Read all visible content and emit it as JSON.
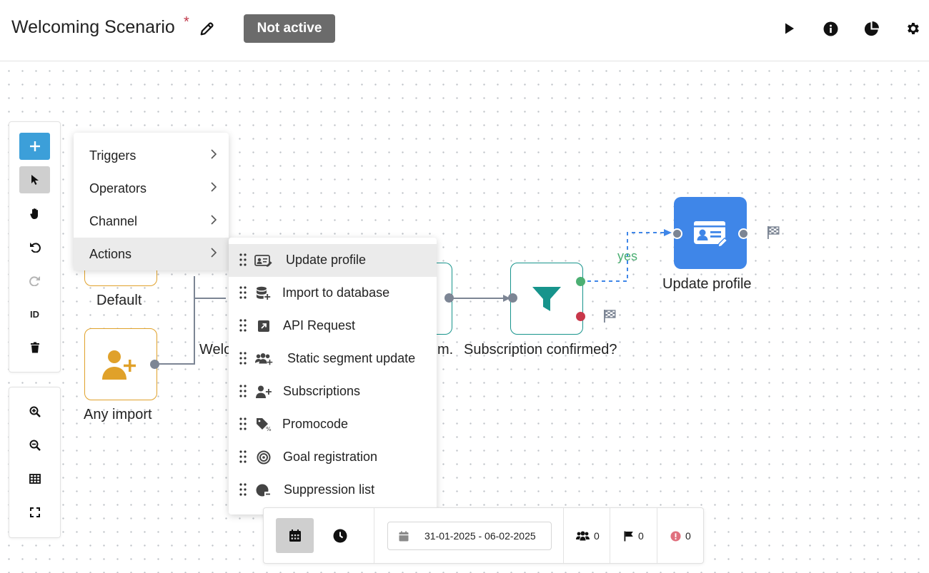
{
  "header": {
    "title": "Welcoming Scenario",
    "unsaved_marker": "*",
    "status": "Not active",
    "icons": [
      "pencil-icon",
      "play-icon",
      "info-icon",
      "pie-chart-icon",
      "gear-icon"
    ]
  },
  "toolbar": {
    "tools": [
      "plus-icon",
      "pointer-icon",
      "hand-icon",
      "undo-icon",
      "redo-icon",
      "ID",
      "trash-icon"
    ],
    "id_label": "ID",
    "zoom_tools": [
      "zoom-in-icon",
      "zoom-out-icon",
      "grid-icon",
      "fit-screen-icon"
    ],
    "accent_color": "#3c9fd9"
  },
  "nodes": {
    "default_label": "Default",
    "any_import_label": "Any import",
    "welcome_label_fragment": "Welc",
    "hidden_label_fragment": "m.",
    "subscription_label": "Subscription confirmed?",
    "update_profile_label": "Update profile",
    "yes_label": "yes",
    "colors": {
      "trigger_border": "#e0a12a",
      "filter": "#17948c",
      "action": "#3f86e8",
      "yes": "#4caf73",
      "no": "#c8374a"
    }
  },
  "menu": {
    "items": [
      {
        "label": "Triggers"
      },
      {
        "label": "Operators"
      },
      {
        "label": "Channel"
      },
      {
        "label": "Actions",
        "selected": true
      }
    ]
  },
  "submenu": {
    "items": [
      {
        "label": "Update profile",
        "icon": "contact-card-edit-icon",
        "selected": true
      },
      {
        "label": "Import to database",
        "icon": "database-plus-icon"
      },
      {
        "label": "API Request",
        "icon": "api-arrow-icon"
      },
      {
        "label": "Static segment update",
        "icon": "users-plus-icon"
      },
      {
        "label": "Subscriptions",
        "icon": "user-plus-icon"
      },
      {
        "label": "Promocode",
        "icon": "tag-percent-icon"
      },
      {
        "label": "Goal registration",
        "icon": "target-icon"
      },
      {
        "label": "Suppression list",
        "icon": "user-minus-icon"
      }
    ]
  },
  "bottombar": {
    "date_range": "31-01-2025 - 06-02-2025",
    "users_count": "0",
    "finished_count": "0",
    "errors_count": "0"
  }
}
